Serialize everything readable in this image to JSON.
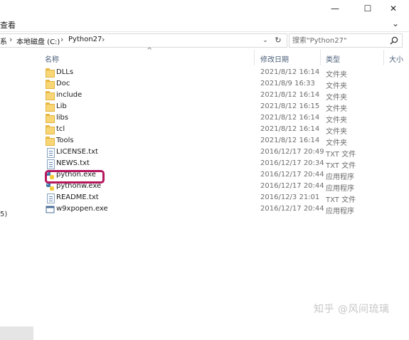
{
  "window": {
    "controls": {
      "minimize": "—",
      "maximize": "☐",
      "close": "✕"
    }
  },
  "menu": {
    "partial_label": "查看",
    "chevron": "⌄"
  },
  "addressbar": {
    "partial_segment": "系",
    "segments": [
      "本地磁盘 (C:)",
      "Python27"
    ],
    "separator": "›",
    "dropdown": "⌄",
    "refresh": "↻"
  },
  "search": {
    "placeholder": "搜索\"Python27\""
  },
  "nav_pane": {
    "partial_item": "5)"
  },
  "columns": {
    "name": "名称",
    "date": "修改日期",
    "type": "类型",
    "size": "大小",
    "sort_arrow": "^"
  },
  "files": [
    {
      "name": "DLLs",
      "date": "2021/8/12 16:14",
      "type": "文件夹",
      "icon": "folder-icon"
    },
    {
      "name": "Doc",
      "date": "2021/8/9 16:33",
      "type": "文件夹",
      "icon": "folder-icon"
    },
    {
      "name": "include",
      "date": "2021/8/12 16:14",
      "type": "文件夹",
      "icon": "folder-icon"
    },
    {
      "name": "Lib",
      "date": "2021/8/12 16:15",
      "type": "文件夹",
      "icon": "folder-icon"
    },
    {
      "name": "libs",
      "date": "2021/8/12 16:14",
      "type": "文件夹",
      "icon": "folder-icon"
    },
    {
      "name": "tcl",
      "date": "2021/8/12 16:14",
      "type": "文件夹",
      "icon": "folder-icon"
    },
    {
      "name": "Tools",
      "date": "2021/8/12 16:14",
      "type": "文件夹",
      "icon": "folder-icon"
    },
    {
      "name": "LICENSE.txt",
      "date": "2016/12/17 20:49",
      "type": "TXT 文件",
      "icon": "text-file-icon"
    },
    {
      "name": "NEWS.txt",
      "date": "2016/12/17 20:34",
      "type": "TXT 文件",
      "icon": "text-file-icon"
    },
    {
      "name": "python.exe",
      "date": "2016/12/17 20:44",
      "type": "应用程序",
      "icon": "python-exe-icon"
    },
    {
      "name": "pythonw.exe",
      "date": "2016/12/17 20:44",
      "type": "应用程序",
      "icon": "python-exe-icon"
    },
    {
      "name": "README.txt",
      "date": "2016/12/3 21:01",
      "type": "TXT 文件",
      "icon": "text-file-icon"
    },
    {
      "name": "w9xpopen.exe",
      "date": "2016/12/17 20:44",
      "type": "应用程序",
      "icon": "exe-window-icon"
    }
  ],
  "watermark": "知乎 @风间琉璃"
}
